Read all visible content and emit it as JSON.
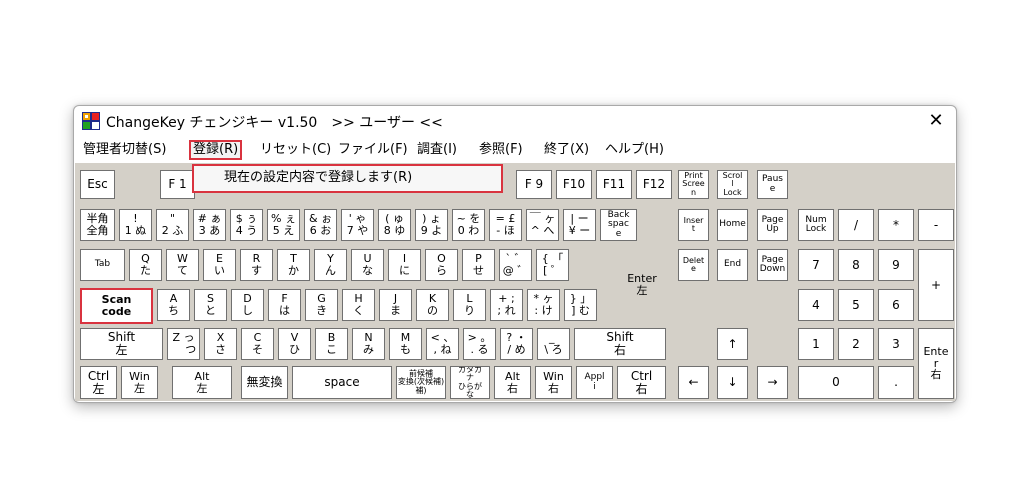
{
  "window": {
    "title": "ChangeKey チェンジキー v1.50　>> ユーザー <<",
    "close_glyph": "✕"
  },
  "menu": {
    "items": [
      "管理者切替(S)",
      "登録(R)",
      "リセット(C)",
      "ファイル(F)",
      "調査(I)",
      "参照(F)",
      "終了(X)",
      "ヘルプ(H)"
    ],
    "highlighted": "登録(R)"
  },
  "dropdown": {
    "item": "現在の設定内容で登録します(R)"
  },
  "keys": {
    "esc": "Esc",
    "f1": "F 1",
    "f9": "F 9",
    "f10": "F10",
    "f11": "F11",
    "f12": "F12",
    "print_screen": "Print\nScree\nn",
    "scroll_lock": "Scrol\nl\nLock",
    "pause": "Paus\ne",
    "hankaku": "半角\n全角",
    "n1": "!\n1 ぬ",
    "n2": "\"\n2 ふ",
    "n3": "# ぁ\n3 あ",
    "n4": "$ ぅ\n4 う",
    "n5": "% ぇ\n5 え",
    "n6": "& ぉ\n6 お",
    "n7": "' ゃ\n7 や",
    "n8": "( ゅ\n8 ゆ",
    "n9": ") ょ\n9 よ",
    "n0": "~ を\n0 わ",
    "minus": "= £\n- ほ",
    "caret": "￣ ヶ\n^ へ",
    "yen": "| ー\n¥ ー",
    "backspace": "Back\nspac\ne",
    "insert": "Inser\nt",
    "home": "Home",
    "page_up": "Page\nUp",
    "num_lock": "Num\nLock",
    "num_slash": "/",
    "num_star": "*",
    "num_minus": "-",
    "tab": "Tab",
    "q": "Q\nた",
    "w": "W\nて",
    "e": "E\nい",
    "r": "R\nす",
    "t": "T\nか",
    "y": "Y\nん",
    "u": "U\nな",
    "i": "I\nに",
    "o": "O\nら",
    "p": "P\nせ",
    "at": "` ゛\n@ ゛",
    "bracket_open": "{ 「\n[ ゜",
    "enter": "Enter\n左",
    "delete": "Delet\ne",
    "end": "End",
    "page_down": "Page\nDown",
    "num7": "7",
    "num8": "8",
    "num9": "9",
    "num_plus": "+",
    "scan_code": "Scan\ncode",
    "a": "A\nち",
    "s": "S\nと",
    "d": "D\nし",
    "f": "F\nは",
    "g": "G\nき",
    "h": "H\nく",
    "j": "J\nま",
    "k": "K\nの",
    "l": "L\nり",
    "semicolon": "+ ;\n; れ",
    "colon": "* ヶ\n: け",
    "bracket_close": "} 」\n] む",
    "num4": "4",
    "num5": "5",
    "num6": "6",
    "shift_left": "Shift\n左",
    "z": "Z っ\n　 つ",
    "x": "X\nさ",
    "c": "C\nそ",
    "v": "V\nひ",
    "b": "B\nこ",
    "n": "N\nみ",
    "m": "M\nも",
    "comma": "< 、\n, ね",
    "period": "> 。\n. る",
    "slash": "? ・\n/ め",
    "backslash": "_ \n\\ ろ",
    "shift_right": "Shift\n右",
    "arrow_up": "↑",
    "num1": "1",
    "num2": "2",
    "num3": "3",
    "num_enter": "Ente\nr\n右",
    "ctrl_left": "Ctrl\n左",
    "win_left": "Win\n左",
    "alt_left": "Alt\n左",
    "muhenkan": "無変換",
    "space": "space",
    "henkan": "前候補\n変換(次候補)\n補)",
    "kana": "カタカ\nナ\nひらが\nな",
    "alt_right": "Alt\n右",
    "win_right": "Win\n右",
    "apps": "Appl\ni",
    "ctrl_right": "Ctrl\n右",
    "arrow_left": "←",
    "arrow_down": "↓",
    "arrow_right": "→",
    "num0": "0",
    "num_dot": "."
  },
  "colors": {
    "highlight_border": "#d9333f",
    "keyboard_bg": "#d4d0c8"
  }
}
